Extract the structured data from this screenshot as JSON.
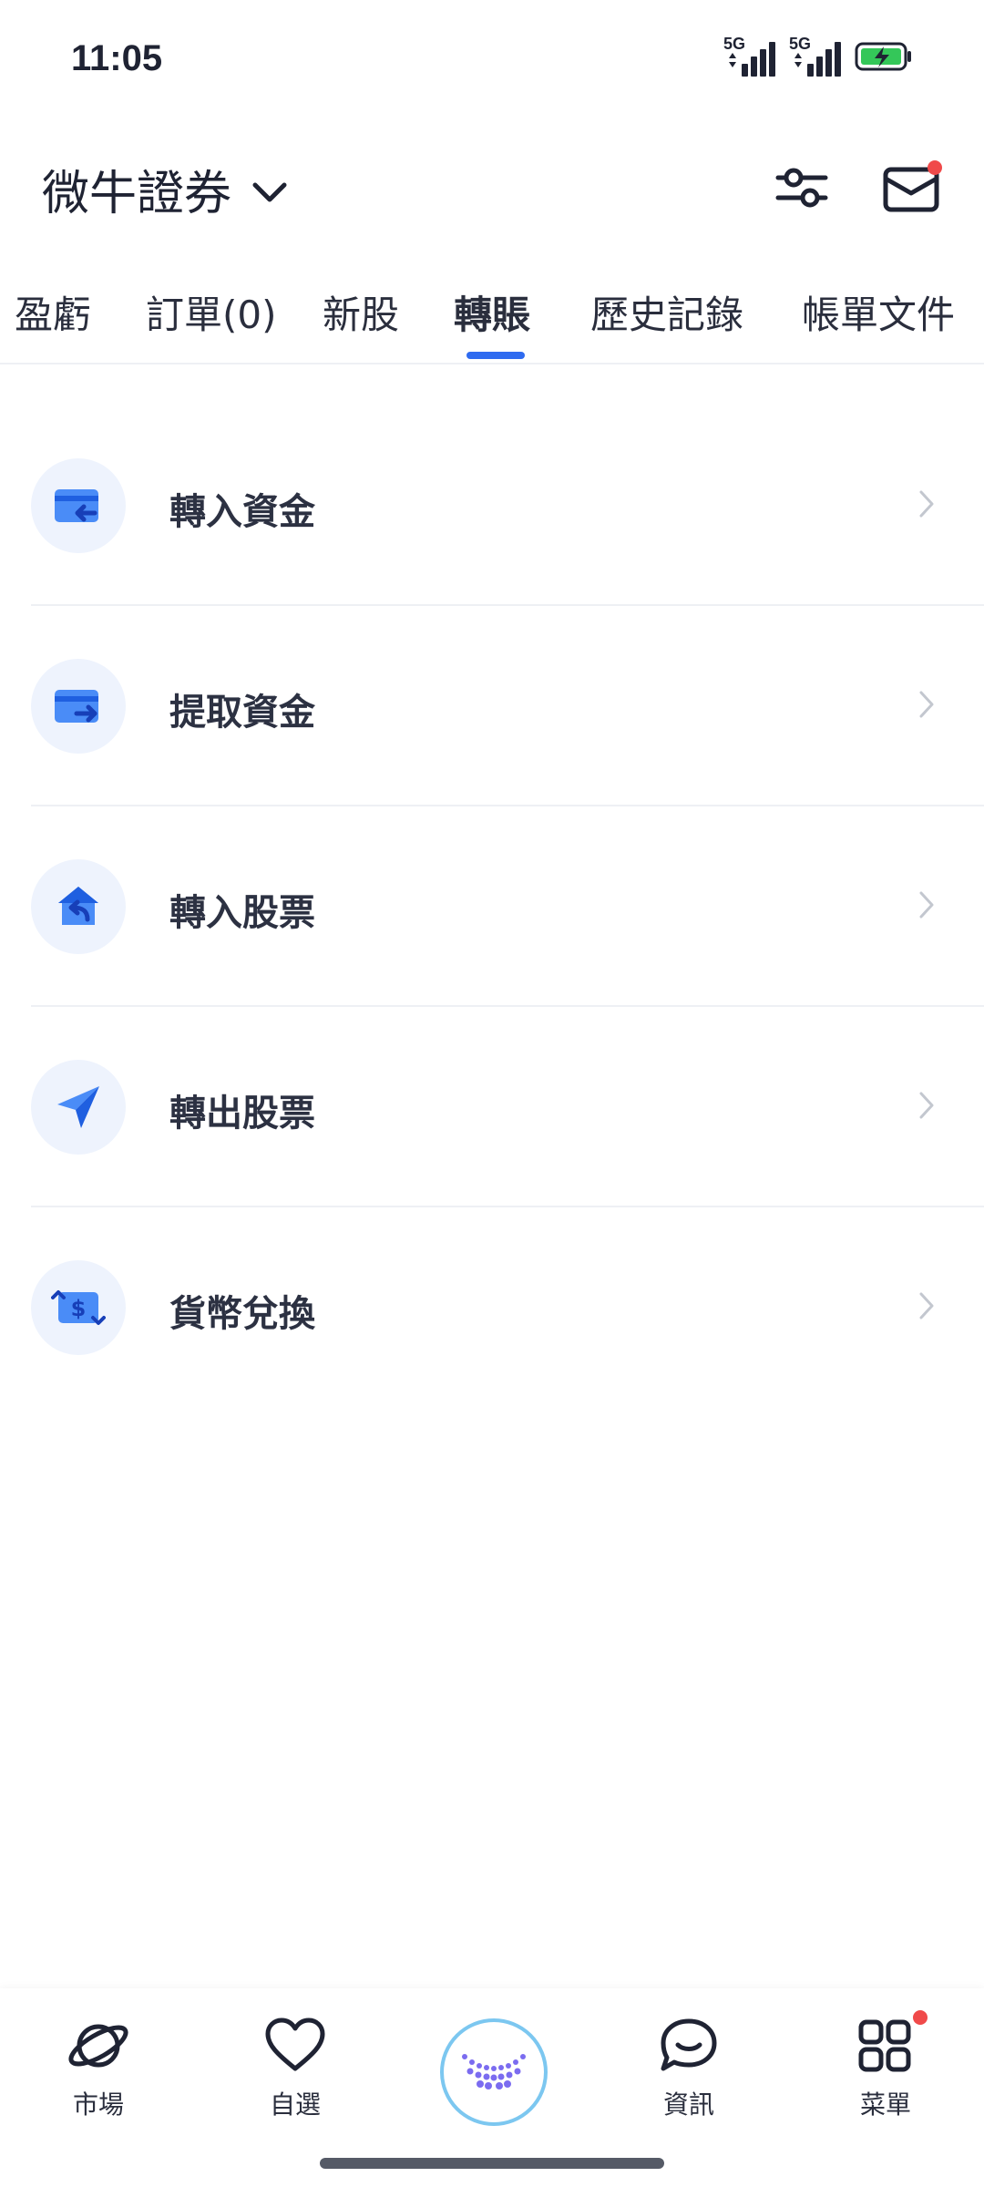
{
  "status": {
    "time": "11:05",
    "network1": "5G",
    "network2": "5G"
  },
  "header": {
    "broker": "微牛證券"
  },
  "tabs": [
    {
      "label": "盈虧"
    },
    {
      "label": "訂單(0)"
    },
    {
      "label": "新股"
    },
    {
      "label": "轉賬"
    },
    {
      "label": "歷史記錄"
    },
    {
      "label": "帳單文件"
    }
  ],
  "active_tab": "轉賬",
  "menu": [
    {
      "label": "轉入資金",
      "icon": "card-in-icon"
    },
    {
      "label": "提取資金",
      "icon": "card-out-icon"
    },
    {
      "label": "轉入股票",
      "icon": "house-return-icon"
    },
    {
      "label": "轉出股票",
      "icon": "send-icon"
    },
    {
      "label": "貨幣兌換",
      "icon": "currency-exchange-icon"
    }
  ],
  "bottom_nav": [
    {
      "label": "市場",
      "icon": "planet-icon"
    },
    {
      "label": "自選",
      "icon": "heart-icon"
    },
    {
      "label": "",
      "icon": "assistant-icon"
    },
    {
      "label": "資訊",
      "icon": "chat-icon"
    },
    {
      "label": "菜單",
      "icon": "grid-icon"
    }
  ],
  "colors": {
    "accent": "#2f6bf0",
    "icon_bg": "#eef3fd",
    "notification": "#f04a4a",
    "text": "#2c3142"
  }
}
